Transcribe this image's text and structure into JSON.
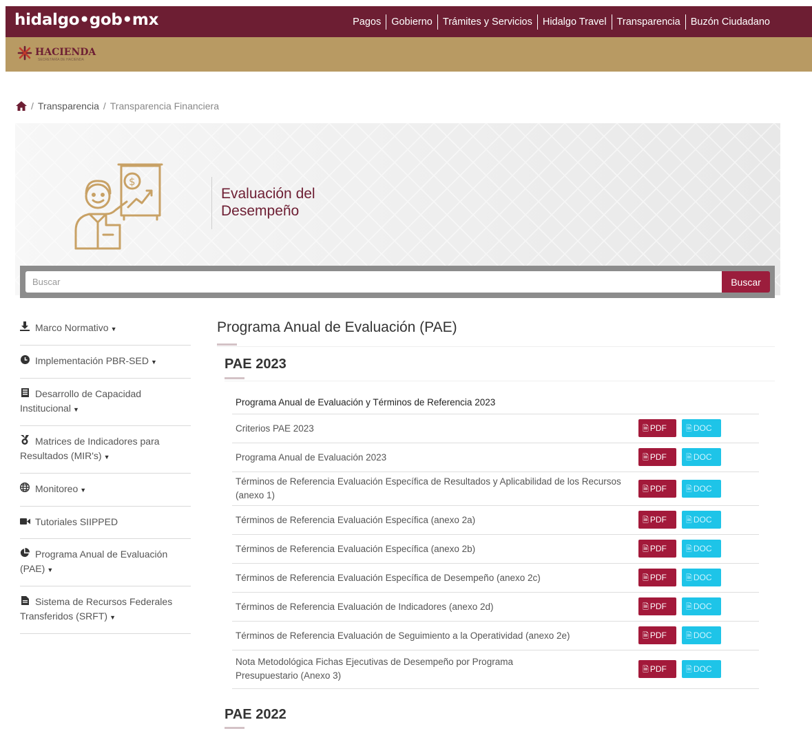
{
  "header": {
    "brand": "hidalgo•gob•mx",
    "nav": [
      "Pagos",
      "Gobierno",
      "Trámites y Servicios",
      "Hidalgo Travel",
      "Transparencia",
      "Buzón Ciudadano"
    ]
  },
  "secretaria": {
    "name": "HACIENDA",
    "subtitle": "SECRETARÍA DE HACIENDA"
  },
  "breadcrumb": {
    "items": [
      "Transparencia",
      "Transparencia Financiera"
    ]
  },
  "hero": {
    "title": "Evaluación del Desempeño"
  },
  "search": {
    "placeholder": "Buscar",
    "button": "Buscar"
  },
  "sidebar": {
    "items": [
      {
        "label": "Marco Normativo",
        "icon": "download-icon",
        "caret": true
      },
      {
        "label": "Implementación PBR-SED",
        "icon": "clock-icon",
        "caret": true
      },
      {
        "label": "Desarrollo de Capacidad Institucional",
        "icon": "book-icon",
        "caret": true
      },
      {
        "label": "Matrices de Indicadores para Resultados (MIR's)",
        "icon": "medal-icon",
        "caret": true
      },
      {
        "label": "Monitoreo",
        "icon": "globe-icon",
        "caret": true
      },
      {
        "label": "Tutoriales SIIPPED",
        "icon": "video-icon",
        "caret": false
      },
      {
        "label": "Programa Anual de Evaluación (PAE)",
        "icon": "pie-chart-icon",
        "caret": true
      },
      {
        "label": "Sistema de Recursos Federales Transferidos (SRFT)",
        "icon": "file-icon",
        "caret": true
      }
    ]
  },
  "main": {
    "title": "Programa Anual de Evaluación (PAE)",
    "section_2023": "PAE 2023",
    "table_header": "Programa Anual de Evaluación y Términos de Referencia 2023",
    "pdf_label": "PDF",
    "doc_label": "DOC",
    "rows": [
      "Criterios PAE 2023",
      "Programa Anual de Evaluación 2023",
      "Términos de Referencia Evaluación Específica de Resultados y Aplicabilidad de los Recursos (anexo 1)",
      "Términos de Referencia Evaluación Específica (anexo 2a)",
      "Términos de Referencia Evaluación Específica (anexo 2b)",
      "Términos de Referencia Evaluación Específica de Desempeño (anexo 2c)",
      "Términos de Referencia Evaluación de Indicadores (anexo 2d)",
      "Términos de Referencia Evaluación de Seguimiento a la Operatividad (anexo 2e)",
      "Nota Metodológica Fichas Ejecutivas de Desempeño por Programa Presupuestario (Anexo 3)"
    ],
    "section_2022": "PAE 2022"
  },
  "colors": {
    "primary": "#6d1e33",
    "gold": "#b89a63",
    "pdf": "#a3193a",
    "doc": "#1ec4e8"
  }
}
